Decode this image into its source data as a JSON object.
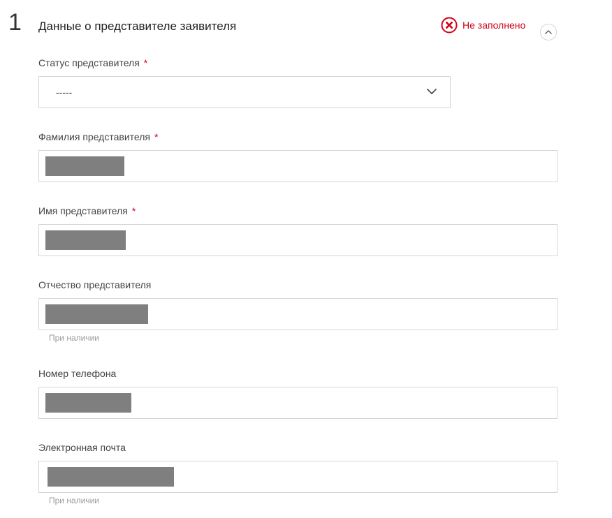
{
  "section": {
    "number": "1",
    "title": "Данные о представителе заявителя",
    "status_text": "Не заполнено",
    "accent_color": "#d0021b"
  },
  "fields": {
    "status": {
      "label": "Статус представителя",
      "required_mark": "*",
      "value": "-----"
    },
    "last_name": {
      "label": "Фамилия представителя",
      "required_mark": "*"
    },
    "first_name": {
      "label": "Имя представителя",
      "required_mark": "*"
    },
    "patronymic": {
      "label": "Отчество представителя",
      "hint": "При наличии"
    },
    "phone": {
      "label": "Номер телефона"
    },
    "email": {
      "label": "Электронная почта",
      "hint": "При наличии"
    }
  },
  "icons": {
    "status": "error-circle-icon",
    "collapse": "chevron-up-icon",
    "dropdown": "chevron-down-icon"
  }
}
